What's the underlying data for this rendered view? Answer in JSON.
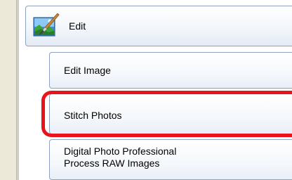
{
  "group": {
    "label": "Edit",
    "icon": "edit-image-icon"
  },
  "items": [
    {
      "label": "Edit Image"
    },
    {
      "label": "Stitch Photos",
      "highlighted": true
    },
    {
      "label_lines": [
        "Digital Photo Professional",
        "Process RAW Images"
      ]
    }
  ],
  "colors": {
    "highlight": "#e8131b",
    "button_border": "#8ea1c0"
  }
}
